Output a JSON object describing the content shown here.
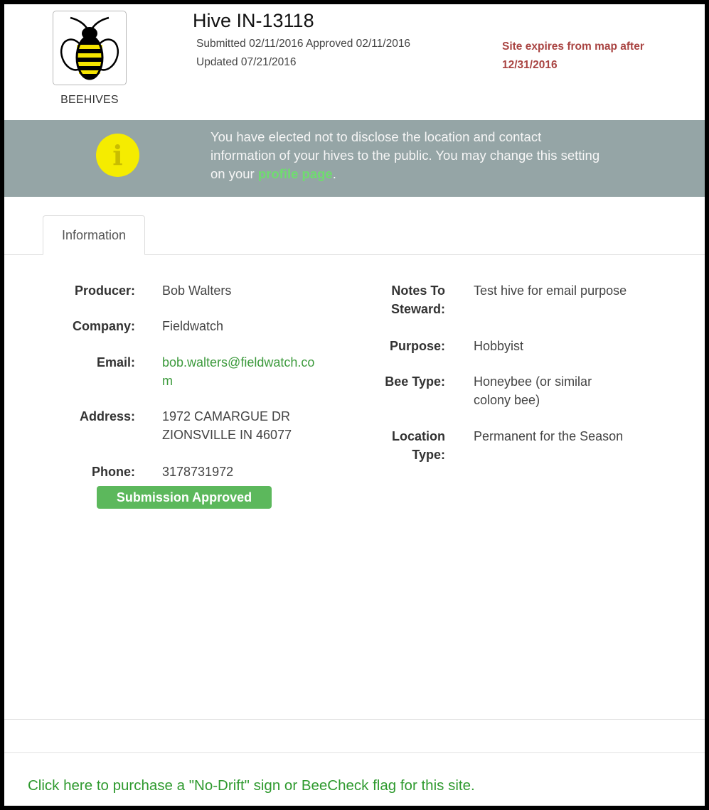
{
  "header": {
    "logo_label": "BEEHIVES",
    "title": "Hive IN-13118",
    "meta_line1": "Submitted 02/11/2016  Approved 02/11/2016",
    "meta_line2": "Updated 07/21/2016",
    "expires_line1": "Site expires from map after",
    "expires_line2": "12/31/2016"
  },
  "banner": {
    "icon": "info-icon",
    "icon_glyph": "i",
    "line1": "You have elected not to disclose the location and contact",
    "line2": "information of your hives to the public. You may change this setting",
    "line3_prefix": "on your ",
    "link_text": "profile page",
    "line3_suffix": "."
  },
  "tabs": [
    {
      "label": "Information"
    }
  ],
  "left_fields": {
    "producer_label": "Producer:",
    "producer_value": "Bob Walters",
    "company_label": "Company:",
    "company_value": "Fieldwatch",
    "email_label": "Email:",
    "email_value_line1": "bob.walters@fieldwatch.co",
    "email_value_line2": "m",
    "address_label": "Address:",
    "address_line1": "1972 CAMARGUE DR",
    "address_line2": "ZIONSVILLE IN 46077",
    "phone_label": "Phone:",
    "phone_value": "3178731972"
  },
  "status_badge": "Submission Approved",
  "right_fields": {
    "notes_label_line1": "Notes To",
    "notes_label_line2": "Steward:",
    "notes_value": "Test hive for email purpose",
    "purpose_label": "Purpose:",
    "purpose_value": "Hobbyist",
    "bee_type_label": "Bee Type:",
    "bee_type_line1": "Honeybee (or similar",
    "bee_type_line2": "colony bee)",
    "location_label_line1": "Location",
    "location_label_line2": "Type:",
    "location_value": "Permanent for the Season"
  },
  "footer": {
    "purchase_link": "Click here to purchase a \"No-Drift\" sign or BeeCheck flag for this site."
  },
  "colors": {
    "banner_bg": "#95a5a6",
    "info_icon": "#f5ec00",
    "expires_text": "#a94442",
    "link_green": "#3c9a3c",
    "badge_green": "#5cb85c"
  }
}
